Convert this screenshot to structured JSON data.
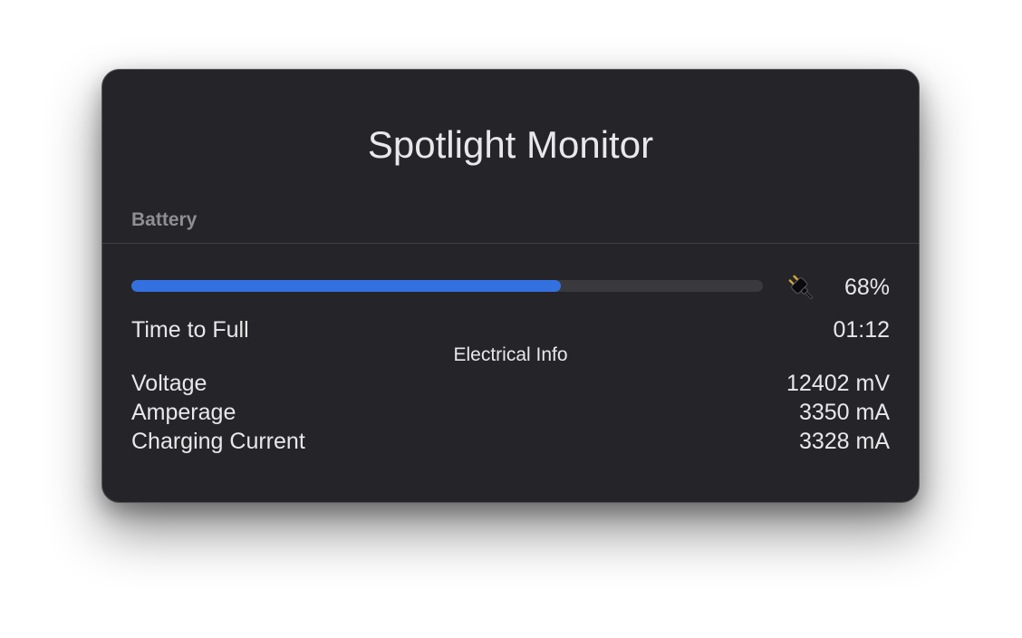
{
  "window": {
    "title": "Spotlight Monitor"
  },
  "battery": {
    "section_label": "Battery",
    "charge_percent": 68,
    "charge_label": "68%",
    "power_source_icon": "plug-icon",
    "time_to_full": {
      "label": "Time to Full",
      "value": "01:12"
    }
  },
  "electrical": {
    "header": "Electrical Info",
    "rows": [
      {
        "label": "Voltage",
        "value": "12402 mV"
      },
      {
        "label": "Amperage",
        "value": "3350 mA"
      },
      {
        "label": "Charging Current",
        "value": "3328 mA"
      }
    ]
  },
  "colors": {
    "window_background": "#252529",
    "progress_fill": "#3471e0",
    "progress_track": "#3a3a3e",
    "section_label": "#8e8e93",
    "text": "#e8e8ea"
  }
}
